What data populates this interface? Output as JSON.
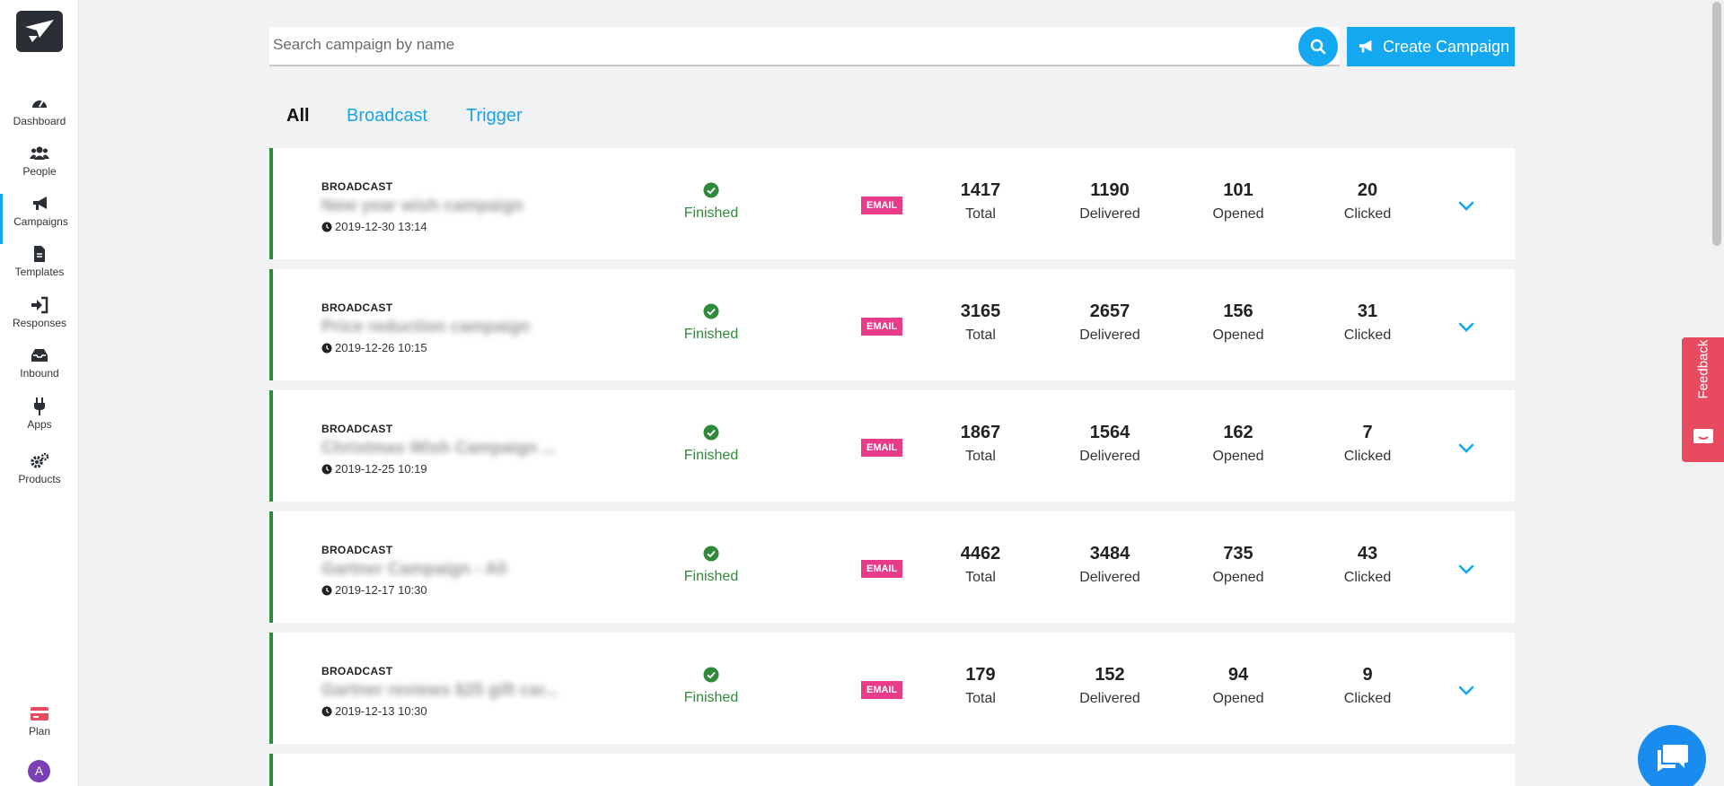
{
  "sidebar": {
    "items": [
      {
        "label": "Dashboard",
        "icon": "dashboard-icon"
      },
      {
        "label": "People",
        "icon": "people-icon"
      },
      {
        "label": "Campaigns",
        "icon": "megaphone-icon",
        "active": true
      },
      {
        "label": "Templates",
        "icon": "file-icon"
      },
      {
        "label": "Responses",
        "icon": "sign-in-icon"
      },
      {
        "label": "Inbound",
        "icon": "inbox-icon"
      },
      {
        "label": "Apps",
        "icon": "plug-icon"
      },
      {
        "label": "Products",
        "icon": "gears-icon"
      }
    ],
    "plan_label": "Plan",
    "avatar_initial": "A"
  },
  "search": {
    "placeholder": "Search campaign by name"
  },
  "create_button": {
    "label": "Create Campaign"
  },
  "tabs": [
    {
      "label": "All",
      "active": true
    },
    {
      "label": "Broadcast"
    },
    {
      "label": "Trigger"
    }
  ],
  "campaigns": [
    {
      "type": "BROADCAST",
      "name": "New year wish campaign",
      "date": "2019-12-30 13:14",
      "status": "Finished",
      "channel": "EMAIL",
      "total": "1417",
      "delivered": "1190",
      "opened": "101",
      "clicked": "20"
    },
    {
      "type": "BROADCAST",
      "name": "Price reduction campaign",
      "date": "2019-12-26 10:15",
      "status": "Finished",
      "channel": "EMAIL",
      "total": "3165",
      "delivered": "2657",
      "opened": "156",
      "clicked": "31"
    },
    {
      "type": "BROADCAST",
      "name": "Christmas Wish Campaign ...",
      "date": "2019-12-25 10:19",
      "status": "Finished",
      "channel": "EMAIL",
      "total": "1867",
      "delivered": "1564",
      "opened": "162",
      "clicked": "7"
    },
    {
      "type": "BROADCAST",
      "name": "Gartner Campaign - All",
      "date": "2019-12-17 10:30",
      "status": "Finished",
      "channel": "EMAIL",
      "total": "4462",
      "delivered": "3484",
      "opened": "735",
      "clicked": "43"
    },
    {
      "type": "BROADCAST",
      "name": "Gartner reviews $25 gift car...",
      "date": "2019-12-13 10:30",
      "status": "Finished",
      "channel": "EMAIL",
      "total": "179",
      "delivered": "152",
      "opened": "94",
      "clicked": "9"
    }
  ],
  "stat_labels": {
    "total": "Total",
    "delivered": "Delivered",
    "opened": "Opened",
    "clicked": "Clicked"
  },
  "feedback_label": "Feedback",
  "colors": {
    "accent": "#13a8f0",
    "success": "#2f8a3a",
    "email_badge": "#e83c8a",
    "feedback": "#e84a5f",
    "chat": "#1a8cf0"
  }
}
